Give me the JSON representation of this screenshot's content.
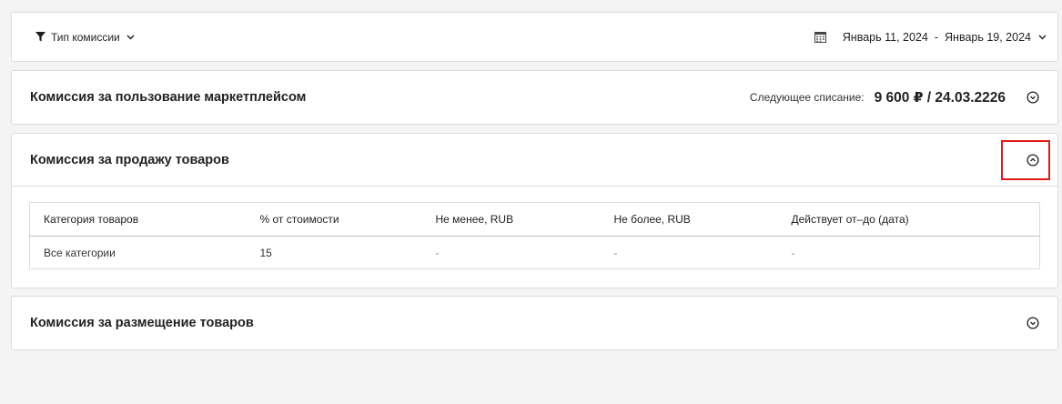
{
  "filter": {
    "commission_type_label": "Тип комиссии",
    "date_from": "Январь 11, 2024",
    "date_separator": "-",
    "date_to": "Январь 19, 2024"
  },
  "sections": {
    "marketplace": {
      "title": "Комиссия за пользование маркетплейсом",
      "next_charge_label": "Следующее списание:",
      "next_charge_value": "9 600 ₽ / 24.03.2226"
    },
    "sales": {
      "title": "Комиссия за продажу товаров",
      "table": {
        "headers": [
          "Категория товаров",
          "% от стоимости",
          "Не менее, RUB",
          "Не более, RUB",
          "Действует от–до (дата)"
        ],
        "rows": [
          [
            "Все категории",
            "15",
            "-",
            "-",
            "-"
          ]
        ]
      }
    },
    "placement": {
      "title": "Комиссия за размещение товаров"
    }
  },
  "colors": {
    "highlight": "#e11b1b",
    "background": "#f4f4f4",
    "border": "#dcdcdc"
  }
}
